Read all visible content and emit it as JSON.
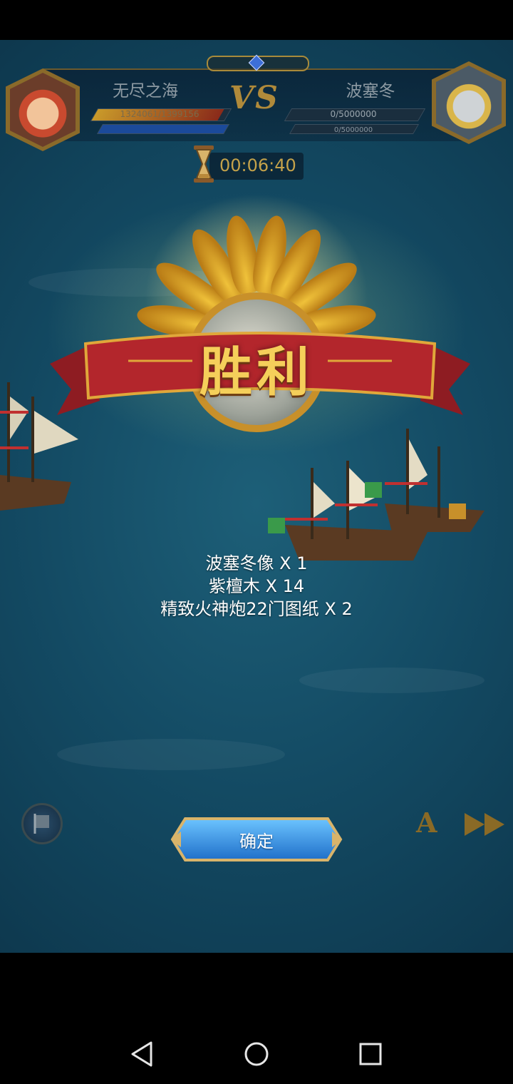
{
  "header": {
    "left_player": {
      "name": "无尽之海",
      "hp_text": "1324061/1399156",
      "hp_fraction": 0.95
    },
    "vs_label": "VS",
    "right_player": {
      "name": "波塞冬",
      "hp_text": "0/5000000",
      "sub_text": "0/5000000",
      "hp_fraction": 0
    }
  },
  "timer": {
    "value": "00:06:40",
    "icon": "hourglass-icon"
  },
  "victory": {
    "title": "胜利"
  },
  "rewards": [
    {
      "text": "波塞冬像 X 1"
    },
    {
      "text": "紫檀木 X 14"
    },
    {
      "text": "精致火神炮22门图纸 X 2"
    }
  ],
  "controls": {
    "confirm_label": "确定",
    "auto_label": "A",
    "speed_icon": "fast-forward-icon",
    "flag_icon": "flag-icon"
  },
  "nav": {
    "back": "back-triangle-icon",
    "home": "home-circle-icon",
    "recents": "recents-square-icon"
  },
  "colors": {
    "gold": "#c4a24a",
    "sea": "#134a63",
    "ribbon_red": "#b3262c",
    "button_blue": "#2f8fe0"
  }
}
